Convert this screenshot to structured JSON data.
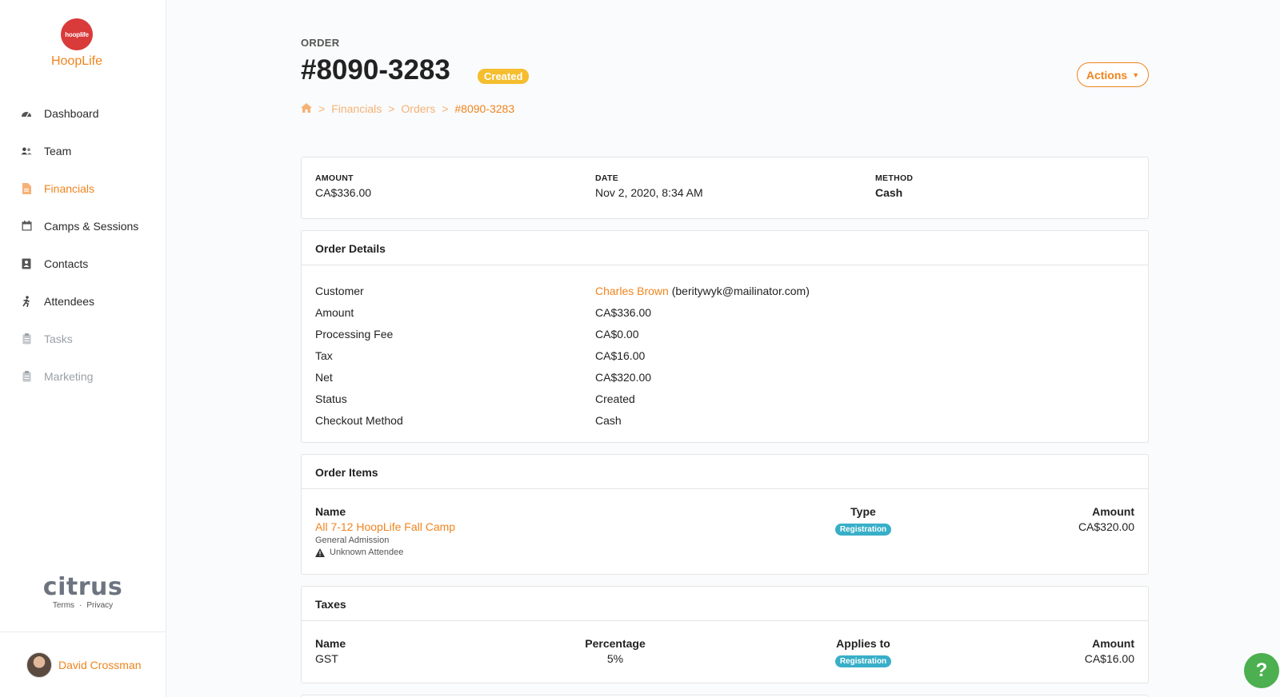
{
  "sidebar": {
    "brand": {
      "logo_text": "hooplife",
      "name": "HoopLife"
    },
    "items": [
      {
        "label": "Dashboard",
        "icon": "gauge-icon"
      },
      {
        "label": "Team",
        "icon": "users-icon"
      },
      {
        "label": "Financials",
        "icon": "file-invoice-icon"
      },
      {
        "label": "Camps & Sessions",
        "icon": "calendar-icon"
      },
      {
        "label": "Contacts",
        "icon": "address-book-icon"
      },
      {
        "label": "Attendees",
        "icon": "running-icon"
      },
      {
        "label": "Tasks",
        "icon": "clipboard-icon"
      },
      {
        "label": "Marketing",
        "icon": "clipboard-icon"
      }
    ],
    "footer": {
      "logo": "citrus",
      "terms": "Terms",
      "dot": "·",
      "privacy": "Privacy"
    },
    "user": {
      "name": "David Crossman"
    }
  },
  "header": {
    "eyebrow": "ORDER",
    "title": "#8090-3283",
    "status_badge": "Created",
    "actions_label": "Actions",
    "breadcrumb": {
      "sep": ">",
      "financials": "Financials",
      "orders": "Orders",
      "current": "#8090-3283"
    }
  },
  "summary": {
    "amount_label": "AMOUNT",
    "amount": "CA$336.00",
    "date_label": "DATE",
    "date": "Nov 2, 2020, 8:34 AM",
    "method_label": "METHOD",
    "method": "Cash"
  },
  "details": {
    "title": "Order Details",
    "customer_label": "Customer",
    "customer_name": "Charles Brown",
    "customer_email": "(beritywyk@mailinator.com)",
    "rows": [
      {
        "k": "Amount",
        "v": "CA$336.00"
      },
      {
        "k": "Processing Fee",
        "v": "CA$0.00"
      },
      {
        "k": "Tax",
        "v": "CA$16.00"
      },
      {
        "k": "Net",
        "v": "CA$320.00"
      },
      {
        "k": "Status",
        "v": "Created"
      },
      {
        "k": "Checkout Method",
        "v": "Cash"
      }
    ]
  },
  "items": {
    "title": "Order Items",
    "col_name": "Name",
    "col_type": "Type",
    "col_amount": "Amount",
    "row": {
      "name": "All 7-12 HoopLife Fall Camp",
      "sub": "General Admission",
      "warning": "Unknown Attendee",
      "type": "Registration",
      "amount": "CA$320.00"
    }
  },
  "taxes": {
    "title": "Taxes",
    "col_name": "Name",
    "col_pct": "Percentage",
    "col_applies": "Applies to",
    "col_amount": "Amount",
    "row": {
      "name": "GST",
      "pct": "5%",
      "applies": "Registration",
      "amount": "CA$16.00"
    }
  },
  "help_label": "?",
  "colors": {
    "accent": "#f0841e",
    "created": "#f5be2f",
    "registration": "#38afc8",
    "help": "#4caf50"
  }
}
